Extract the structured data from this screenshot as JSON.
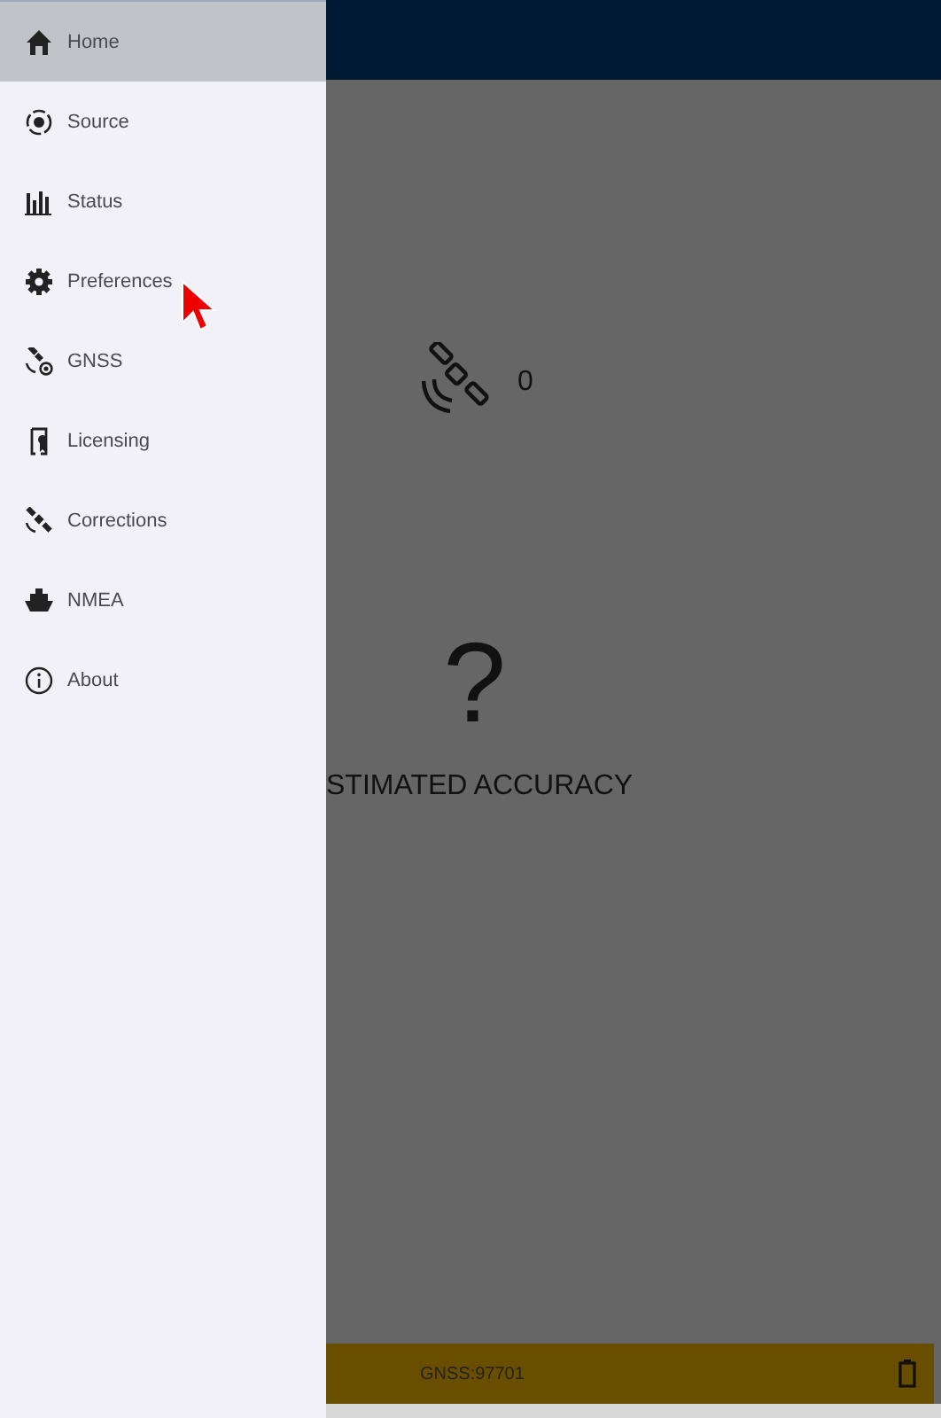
{
  "drawer": {
    "items": [
      {
        "label": "Home",
        "selected": true
      },
      {
        "label": "Source",
        "selected": false
      },
      {
        "label": "Status",
        "selected": false
      },
      {
        "label": "Preferences",
        "selected": false
      },
      {
        "label": "GNSS",
        "selected": false
      },
      {
        "label": "Licensing",
        "selected": false
      },
      {
        "label": "Corrections",
        "selected": false
      },
      {
        "label": "NMEA",
        "selected": false
      },
      {
        "label": "About",
        "selected": false
      }
    ]
  },
  "main": {
    "satellite_count": "0",
    "accuracy_value": "?",
    "accuracy_label": "STIMATED ACCURACY"
  },
  "status_bar": {
    "text": "GNSS:97701"
  }
}
